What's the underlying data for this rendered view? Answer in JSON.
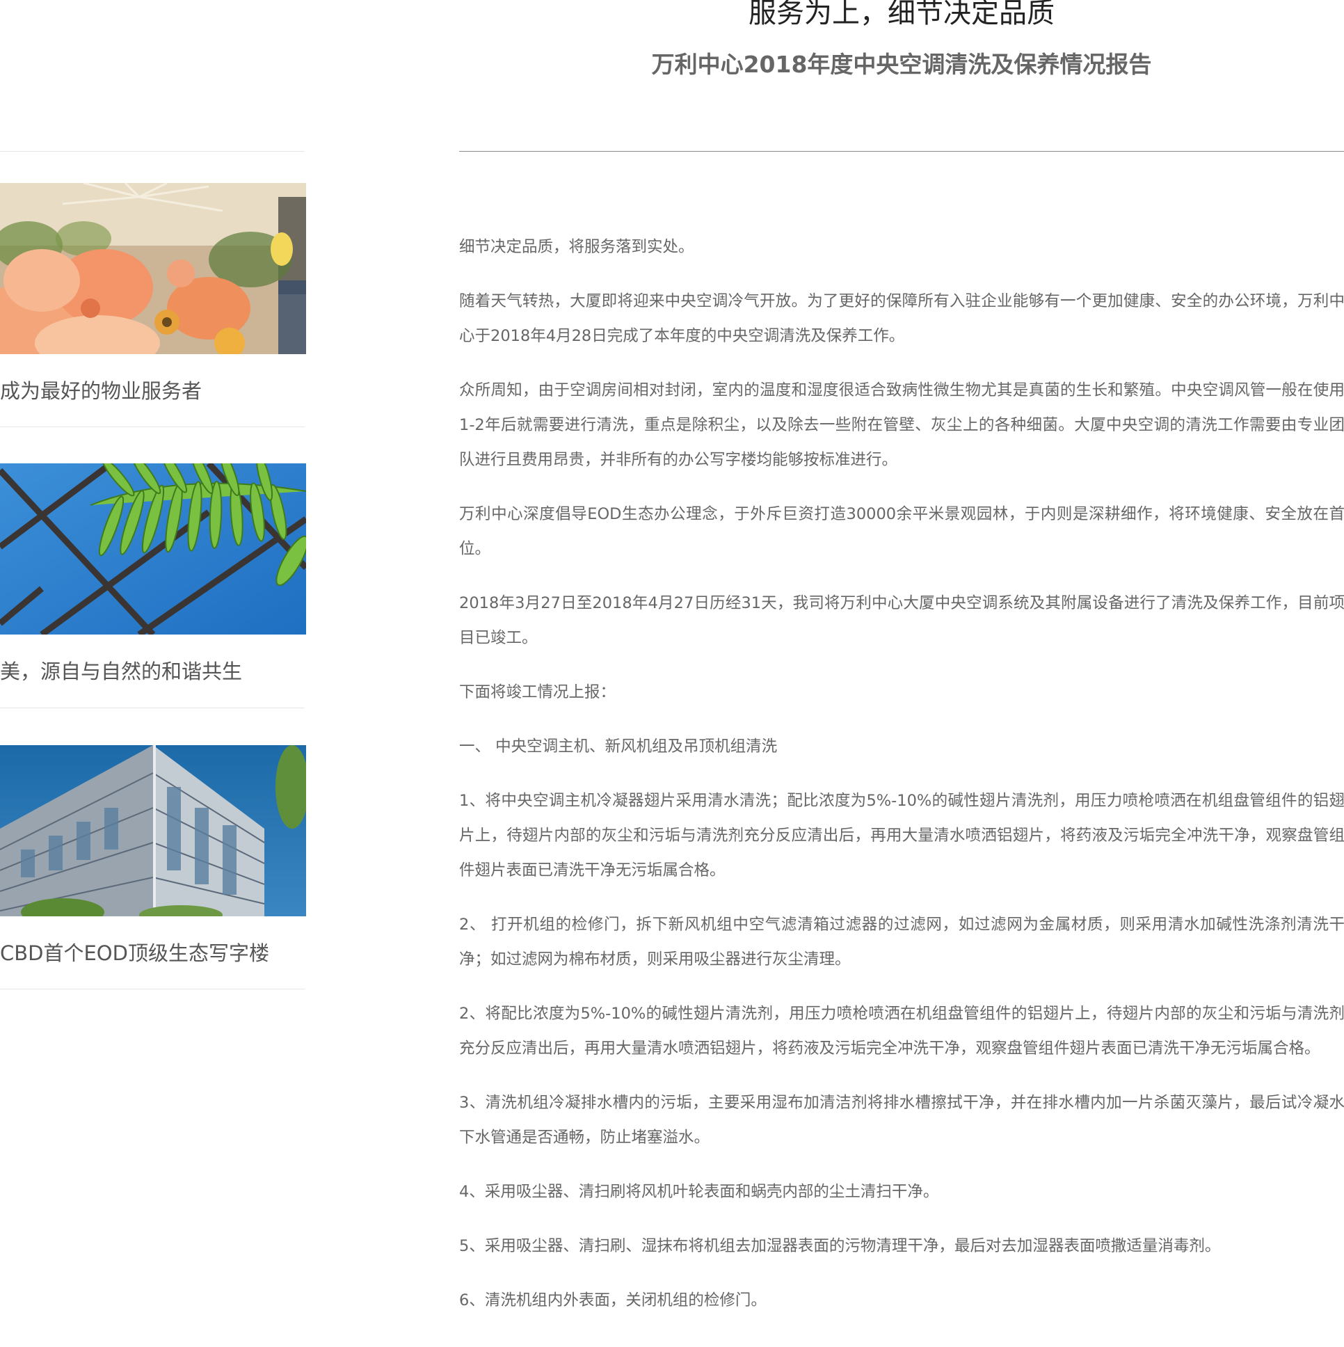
{
  "header": {
    "title": "服务为上，细节决定品质",
    "subtitle": "万利中心2018年度中央空调清洗及保养情况报告"
  },
  "sidebar": {
    "items": [
      {
        "caption": "成为最好的物业服务者",
        "image": "orange-flowers-photo"
      },
      {
        "caption": "美，源自与自然的和谐共生",
        "image": "green-leaf-blue-sky-photo"
      },
      {
        "caption": "CBD首个EOD顶级生态写字楼",
        "image": "glass-office-building-photo"
      }
    ]
  },
  "article": {
    "paragraphs": [
      "细节决定品质，将服务落到实处。",
      "随着天气转热，大厦即将迎来中央空调冷气开放。为了更好的保障所有入驻企业能够有一个更加健康、安全的办公环境，万利中心于2018年4月28日完成了本年度的中央空调清洗及保养工作。",
      "众所周知，由于空调房间相对封闭，室内的温度和湿度很适合致病性微生物尤其是真菌的生长和繁殖。中央空调风管一般在使用1-2年后就需要进行清洗，重点是除积尘，以及除去一些附在管壁、灰尘上的各种细菌。大厦中央空调的清洗工作需要由专业团队进行且费用昂贵，并非所有的办公写字楼均能够按标准进行。",
      "万利中心深度倡导EOD生态办公理念，于外斥巨资打造30000余平米景观园林，于内则是深耕细作，将环境健康、安全放在首位。",
      "2018年3月27日至2018年4月27日历经31天，我司将万利中心大厦中央空调系统及其附属设备进行了清洗及保养工作，目前项目已竣工。",
      "下面将竣工情况上报：",
      "一、 中央空调主机、新风机组及吊顶机组清洗",
      "1、将中央空调主机冷凝器翅片采用清水清洗；配比浓度为5%-10%的碱性翅片清洗剂，用压力喷枪喷洒在机组盘管组件的铝翅片上，待翅片内部的灰尘和污垢与清洗剂充分反应清出后，再用大量清水喷洒铝翅片，将药液及污垢完全冲洗干净，观察盘管组件翅片表面已清洗干净无污垢属合格。",
      "2、 打开机组的检修门，拆下新风机组中空气滤清箱过滤器的过滤网，如过滤网为金属材质，则采用清水加碱性洗涤剂清洗干净；如过滤网为棉布材质，则采用吸尘器进行灰尘清理。",
      "2、将配比浓度为5%-10%的碱性翅片清洗剂，用压力喷枪喷洒在机组盘管组件的铝翅片上，待翅片内部的灰尘和污垢与清洗剂充分反应清出后，再用大量清水喷洒铝翅片，将药液及污垢完全冲洗干净，观察盘管组件翅片表面已清洗干净无污垢属合格。",
      "3、清洗机组冷凝排水槽内的污垢，主要采用湿布加清洁剂将排水槽擦拭干净，并在排水槽内加一片杀菌灭藻片，最后试冷凝水下水管通是否通畅，防止堵塞溢水。",
      "4、采用吸尘器、清扫刷将风机叶轮表面和蜗壳内部的尘土清扫干净。",
      "5、采用吸尘器、清扫刷、湿抹布将机组去加湿器表面的污物清理干净，最后对去加湿器表面喷撒适量消毒剂。",
      "6、清洗机组内外表面，关闭机组的检修门。"
    ]
  }
}
